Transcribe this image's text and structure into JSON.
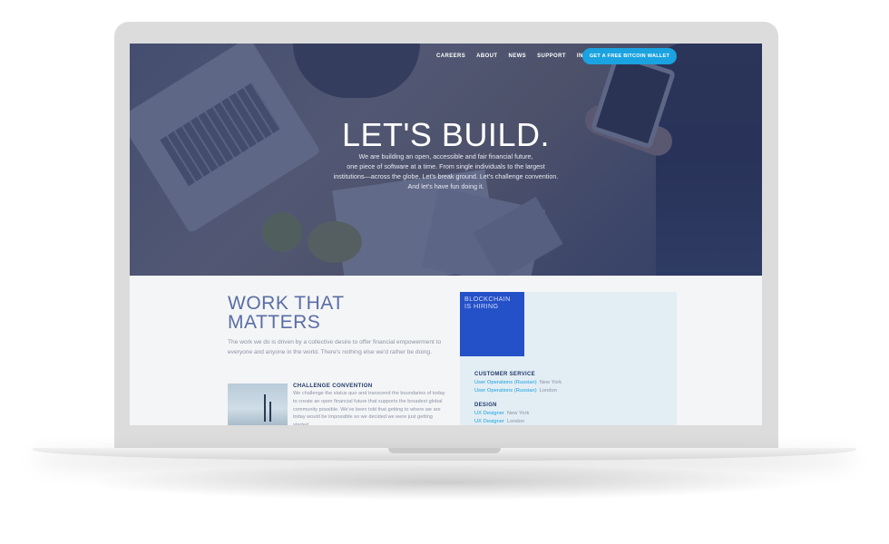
{
  "nav": {
    "links": [
      "CAREERS",
      "ABOUT",
      "NEWS",
      "SUPPORT",
      "INFO"
    ],
    "cta": "GET A FREE BITCOIN WALLET"
  },
  "hero": {
    "title": "LET'S BUILD.",
    "lines": [
      "We are building an open, accessible and fair financial future,",
      "one piece of software at a time. From single individuals to the largest",
      "institutions—across the globe. Let's break ground. Let's challenge convention.",
      "And let's have fun doing it."
    ]
  },
  "work": {
    "title_line1": "WORK THAT",
    "title_line2": "MATTERS",
    "text": "The work we do is driven by a collective desire to offer financial empowerment to everyone and anyone in the world. There's nothing else we'd rather be doing."
  },
  "feature": {
    "title": "CHALLENGE CONVENTION",
    "text": "We challenge the status quo and transcend the boundaries of today to create an open financial future that supports the broadest global community possible. We've been told that getting to where we are today would be impossible so we decided we were just getting started."
  },
  "jobs": {
    "badge_line1": "BLOCKCHAIN",
    "badge_line2": "IS HIRING",
    "sections": [
      {
        "heading": "CUSTOMER SERVICE",
        "rows": [
          {
            "title": "User Operations (Russian)",
            "location": "New York"
          },
          {
            "title": "User Operations (Russian)",
            "location": "London"
          }
        ]
      },
      {
        "heading": "DESIGN",
        "rows": [
          {
            "title": "UX Designer",
            "location": "New York"
          },
          {
            "title": "UX Designer",
            "location": "London"
          }
        ]
      }
    ]
  },
  "colors": {
    "accent": "#1aa3e0",
    "hero_overlay": "#2a3460",
    "badge": "#2450c8",
    "heading": "#5a6ea6"
  }
}
